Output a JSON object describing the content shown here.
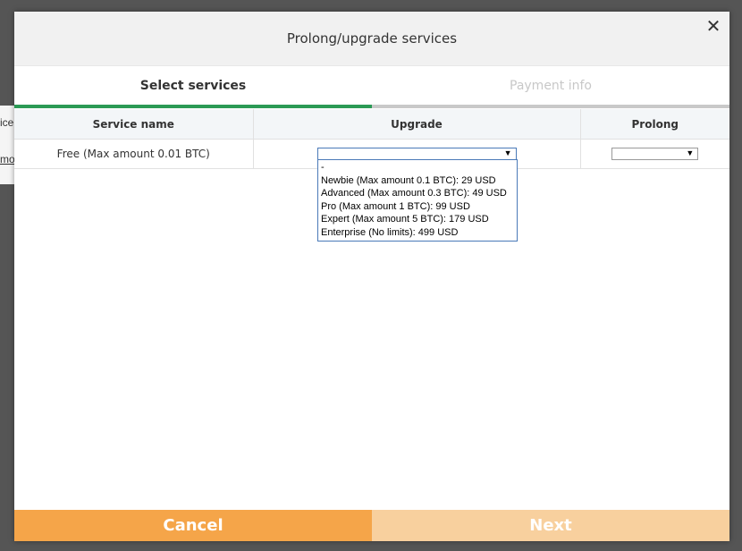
{
  "background": {
    "text_top": "ice",
    "text_link": "mo"
  },
  "modal": {
    "title": "Prolong/upgrade services",
    "close_glyph": "✕"
  },
  "steps": [
    {
      "label": "Select services",
      "active": true
    },
    {
      "label": "Payment info",
      "active": false
    }
  ],
  "table": {
    "headers": [
      "Service name",
      "Upgrade",
      "Prolong"
    ],
    "rows": [
      {
        "service_name": "Free (Max amount 0.01 BTC)",
        "upgrade_value": "",
        "prolong_value": ""
      }
    ]
  },
  "upgrade_options": [
    "-",
    "Newbie (Max amount 0.1 BTC): 29 USD",
    "Advanced (Max amount 0.3 BTC): 49 USD",
    "Pro (Max amount 1 BTC): 99 USD",
    "Expert (Max amount 5 BTC): 179 USD",
    "Enterprise (No limits): 499 USD"
  ],
  "footer": {
    "cancel_label": "Cancel",
    "next_label": "Next"
  },
  "colors": {
    "step_active": "#2b9a55",
    "cancel_button": "#f5a549",
    "next_button_disabled": "#f8d09e"
  },
  "icons": {
    "close": "close-icon",
    "dropdown_arrow": "caret-down-icon"
  }
}
